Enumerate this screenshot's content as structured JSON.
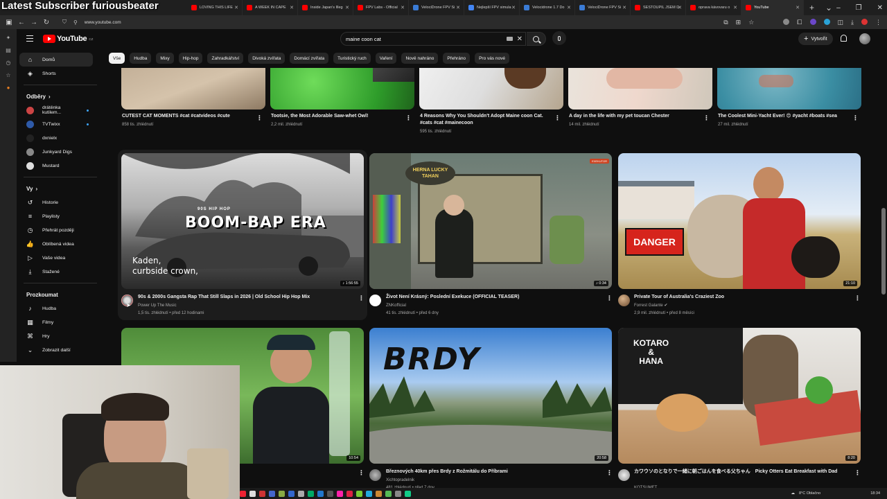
{
  "overlay": {
    "text": "Latest Subscriber furiousbeater"
  },
  "browser": {
    "tabs": [
      {
        "label": "LOVING THIS LIFE",
        "color": "#ff0000"
      },
      {
        "label": "A WEEK IN CAPE",
        "color": "#ff0000"
      },
      {
        "label": "Inside Japan's Illeg",
        "color": "#ff0000"
      },
      {
        "label": "FPV Labs - Official",
        "color": "#ff0000"
      },
      {
        "label": "VelociDrone FPV Si",
        "color": "#3a7bd5"
      },
      {
        "label": "Nejlepší FPV simula",
        "color": "#4285f4"
      },
      {
        "label": "Velocidrone 1.7 Do",
        "color": "#3a7bd5"
      },
      {
        "label": "VelociDrone FPV Si",
        "color": "#3a7bd5"
      },
      {
        "label": "SESTOUPIL JSEM D",
        "color": "#ff0000"
      },
      {
        "label": "oprava kávovaru o",
        "color": "#ff0000"
      },
      {
        "label": "YouTube",
        "color": "#ff0000"
      }
    ],
    "url": "www.youtube.com"
  },
  "header": {
    "logo_text": "YouTube",
    "logo_region": "CZ",
    "search_value": "maine coon cat",
    "create_label": "Vytvořit"
  },
  "nav": {
    "main": [
      {
        "label": "Domů",
        "icon": "home-icon"
      },
      {
        "label": "Shorts",
        "icon": "shorts-icon"
      }
    ],
    "subs_title": "Odběry",
    "subs": [
      {
        "label": "drátěnka kutilem...",
        "color": "#c44"
      },
      {
        "label": "TVTwixx",
        "color": "#2e5aa8"
      },
      {
        "label": "dxnielx",
        "color": "#222"
      },
      {
        "label": "Junkyard Digs",
        "color": "#888"
      },
      {
        "label": "Mustard",
        "color": "#ddd"
      }
    ],
    "you_title": "Vy",
    "you": [
      {
        "label": "Historie",
        "icon": "history-icon"
      },
      {
        "label": "Playlisty",
        "icon": "playlist-icon"
      },
      {
        "label": "Přehrát později",
        "icon": "watch-later-icon"
      },
      {
        "label": "Oblíbená videa",
        "icon": "like-icon"
      },
      {
        "label": "Vaše videa",
        "icon": "your-videos-icon"
      },
      {
        "label": "Stažené",
        "icon": "download-icon"
      }
    ],
    "explore_title": "Prozkoumat",
    "explore": [
      {
        "label": "Hudba",
        "icon": "music-icon"
      },
      {
        "label": "Filmy",
        "icon": "film-icon"
      },
      {
        "label": "Hry",
        "icon": "gaming-icon"
      },
      {
        "label": "Zobrazit další",
        "icon": "chevron-down-icon"
      }
    ]
  },
  "chips": [
    "Vše",
    "Hudba",
    "Mixy",
    "Hip-hop",
    "Zahradkářství",
    "Divoká zvířata",
    "Domácí zvířata",
    "Turistický ruch",
    "Vaření",
    "Nově nahráno",
    "Přehráno",
    "Pro vás nové"
  ],
  "row1": [
    {
      "title": "CUTEST CAT MOMENTS #cat #catvideos #cute",
      "meta": "858 tis. zhlédnutí"
    },
    {
      "title": "Tootsie, the Most Adorable Saw-whet Owl!",
      "meta": "2,2 mil. zhlédnutí"
    },
    {
      "title": "4 Reasons Why You Shouldn't Adopt Maine coon Cat. #cats #cat #mainecoon",
      "meta": "595 tis. zhlédnutí"
    },
    {
      "title": "A day in the life with my pet toucan Chester",
      "meta": "14 mil. zhlédnutí"
    },
    {
      "title": "The Coolest Mini-Yacht Ever! 😍 #yacht #boats #sea",
      "meta": "27 mil. zhlédnutí"
    }
  ],
  "row2": [
    {
      "title": "90s & 2000s Gangsta Rap That Still Slaps in 2026 | Old School Hip Hop Mix",
      "channel": "Power Up The Music",
      "meta": "1,5 tis. zhlédnutí • před 12 hodinami",
      "duration": "1:56:55",
      "thumb_text": "BOOM-BAP ERA",
      "thumb_small": "90S HIP HOP",
      "lyric1": "Kaden,",
      "lyric2": "curbside crown,"
    },
    {
      "title": "Život Není Krásný: Poslední Exekuce (OFFICIAL TEASER)",
      "channel": "ZNKofficial",
      "meta": "41 tis. zhlédnutí • před 6 dny",
      "duration": "0:34",
      "sign_text": "HERNA LUCKY TAHAN",
      "badge": "EXEKUTOR"
    },
    {
      "title": "Private Tour of Australia's Craziest Zoo",
      "channel": "Forrest Galante",
      "meta": "2,9 mil. zhlédnutí • před 8 měsíci",
      "duration": "21:10",
      "danger": "DANGER"
    }
  ],
  "row3": [
    {
      "title": "",
      "channel": "",
      "meta": "",
      "duration": "10:54"
    },
    {
      "title": "Březnových 40km přes Brdy z Rožmitálu do Příbrami",
      "channel": "Xichtopradelnik",
      "meta": "481 zhlédnutí • před 7 dny",
      "duration": "20:58",
      "thumb_text": "BRDY"
    },
    {
      "title": "カワウソのとなりで一緒に朝ごはんを食べる父ちゃん　Picky Otters Eat Breakfast with Dad",
      "channel": "KOTSUMET",
      "meta": "",
      "duration": "8:20",
      "thumb_text1": "KOTARO",
      "thumb_text2": "&",
      "thumb_text3": "HANA"
    }
  ],
  "taskbar": {
    "weather": "8°C Oblačno",
    "time": "18:34"
  }
}
